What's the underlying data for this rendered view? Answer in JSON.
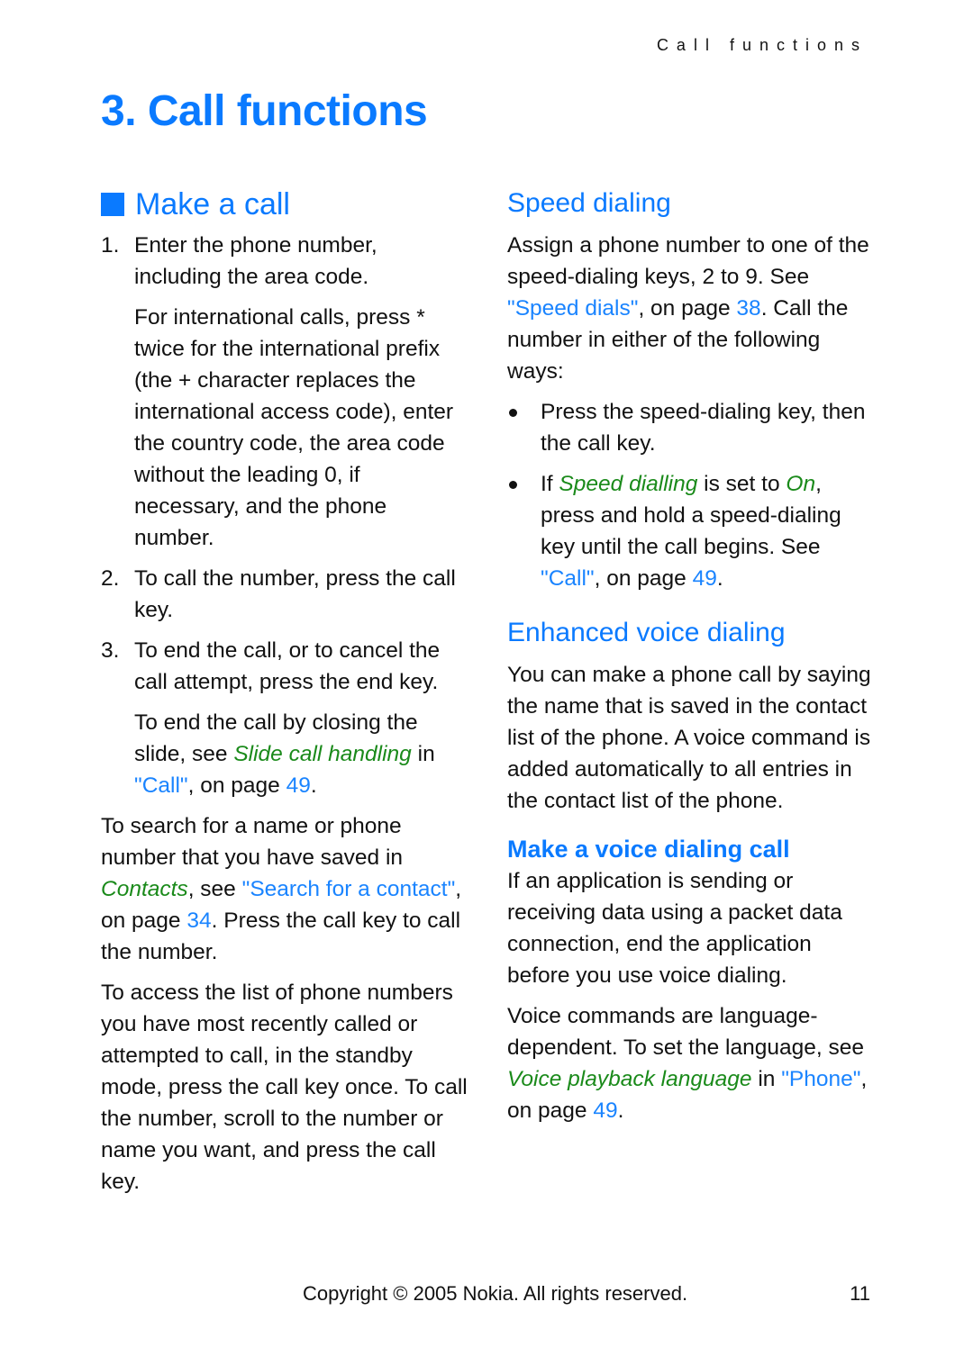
{
  "header": {
    "running_title": "Call functions"
  },
  "chapter": {
    "title": "3. Call functions"
  },
  "colors": {
    "heading_blue": "#0a7aff",
    "link_blue": "#1a84ff",
    "term_green": "#1a8a1a"
  },
  "make_a_call": {
    "heading": "Make a call",
    "step1": {
      "num": "1.",
      "text": "Enter the phone number, including the area code."
    },
    "step1_note": "For international calls, press * twice for the international prefix (the + character replaces the international access code), enter the country code, the area code without the leading 0, if necessary, and the phone number.",
    "step2": {
      "num": "2.",
      "text": "To call the number, press the call key."
    },
    "step3": {
      "num": "3.",
      "text": "To end the call, or to cancel the call attempt, press the end key."
    },
    "step3_note": {
      "pre": "To end the call by closing the slide, see ",
      "term": "Slide call handling",
      "mid": " in ",
      "link": "\"Call\"",
      "post1": ", on page ",
      "page": "49",
      "post2": "."
    },
    "search_para": {
      "pre": "To search for a name or phone number that you have saved in ",
      "term": "Contacts",
      "mid": ", see ",
      "link": "\"Search for a contact\"",
      "post1": ", on page ",
      "page": "34",
      "post2": ". Press the call key to call the number."
    },
    "recent_para": "To access the list of phone numbers you have most recently called or attempted to call, in the standby mode, press the call key once. To call the number, scroll to the number or name you want, and press the call key."
  },
  "speed_dialing": {
    "heading": "Speed dialing",
    "intro": {
      "pre": "Assign a phone number to one of the speed-dialing keys, ",
      "k1": "2",
      "to": " to ",
      "k2": "9",
      "see": ". See ",
      "link": "\"Speed dials\"",
      "post1": ", on page ",
      "page": "38",
      "post2": ". Call the number in either of the following ways:"
    },
    "bullet1": "Press the speed-dialing key, then the call key.",
    "bullet2": {
      "pre": "If ",
      "term1": "Speed dialling",
      "mid": " is set to ",
      "term2": "On",
      "post": ", press and hold a speed-dialing key until the call begins. See ",
      "link": "\"Call\"",
      "post1": ", on page ",
      "page": "49",
      "post2": "."
    }
  },
  "enhanced_voice": {
    "heading": "Enhanced voice dialing",
    "body": "You can make a phone call by saying the name that is saved in the contact list of the phone. A voice command is added automatically to all entries in the contact list of the phone."
  },
  "voice_call": {
    "heading": "Make a voice dialing call",
    "para1": "If an application is sending or receiving data using a packet data connection, end the application before you use voice dialing.",
    "para2": {
      "pre": "Voice commands are language-dependent. To set the language, see ",
      "term": "Voice playback language",
      "mid": " in ",
      "link": "\"Phone\"",
      "post1": ", on page ",
      "page": "49",
      "post2": "."
    }
  },
  "footer": {
    "copyright": "Copyright © 2005 Nokia. All rights reserved.",
    "page_number": "11"
  }
}
